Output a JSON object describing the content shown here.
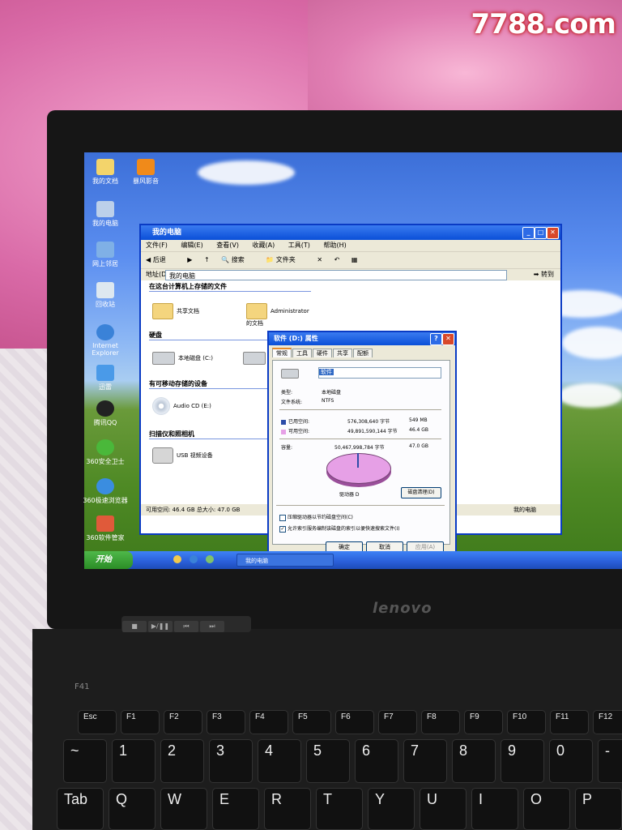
{
  "watermark": "7788.com",
  "desktop_icons": [
    "我的文档",
    "暴风影音",
    "我的电脑",
    "网上邻居",
    "回收站",
    "Internet Explorer",
    "迅雷",
    "腾讯QQ",
    "360安全卫士",
    "360极速浏览器",
    "360软件管家"
  ],
  "window": {
    "title": "我的电脑",
    "menu": [
      "文件(F)",
      "编辑(E)",
      "查看(V)",
      "收藏(A)",
      "工具(T)",
      "帮助(H)"
    ],
    "toolbar": [
      "后退",
      "搜索",
      "文件夹"
    ],
    "address_label": "地址(D)",
    "address_value": "我的电脑",
    "go_label": "转到",
    "section_files": "在这台计算机上存储的文件",
    "shared_docs": "共享文档",
    "admin_docs": "Administrator 的文档",
    "section_drives": "硬盘",
    "local_disk_c": "本地磁盘 (C:)",
    "section_removable": "有可移动存储的设备",
    "audio_cd": "Audio CD (E:)",
    "section_scanners": "扫描仪和照相机",
    "usb_camera": "USB 视频设备",
    "status_left": "可用空间: 46.4 GB 总大小: 47.0 GB",
    "status_right": "我的电脑"
  },
  "dialog": {
    "title": "软件 (D:) 属性",
    "tabs": [
      "常规",
      "工具",
      "硬件",
      "共享",
      "配额"
    ],
    "label_value": "软件",
    "type_label": "类型:",
    "type_value": "本地磁盘",
    "fs_label": "文件系统:",
    "fs_value": "NTFS",
    "used_label": "已用空间:",
    "used_bytes": "576,308,640 字节",
    "used_size": "549 MB",
    "free_label": "可用空间:",
    "free_bytes": "49,891,590,144 字节",
    "free_size": "46.4 GB",
    "cap_label": "容量:",
    "cap_bytes": "50,467,998,784 字节",
    "cap_size": "47.0 GB",
    "drive_label": "驱动器 D",
    "cleanup_button": "磁盘清理(D)",
    "compress_option": "压缩驱动器以节约磁盘空间(C)",
    "index_option": "允许索引服务编制该磁盘的索引以便快速搜索文件(I)",
    "ok_button": "确定",
    "cancel_button": "取消",
    "apply_button": "应用(A)",
    "used_fraction": 0.011,
    "used_color": "#2c4ca8",
    "free_color": "#e6a0e6"
  },
  "taskbar": {
    "start_label": "开始",
    "task_label": "我的电脑"
  },
  "laptop": {
    "brand": "lenovo",
    "model": "F41",
    "fkeys": [
      "Esc",
      "F1",
      "F2",
      "F3",
      "F4",
      "F5",
      "F6",
      "F7",
      "F8",
      "F9",
      "F10",
      "F11",
      "F12"
    ],
    "num_keys": [
      "~",
      "1",
      "2",
      "3",
      "4",
      "5",
      "6",
      "7",
      "8",
      "9",
      "0",
      "-"
    ],
    "alpha_keys": [
      "Tab",
      "Q",
      "W",
      "E",
      "R",
      "T",
      "Y",
      "U",
      "I",
      "O",
      "P"
    ]
  }
}
